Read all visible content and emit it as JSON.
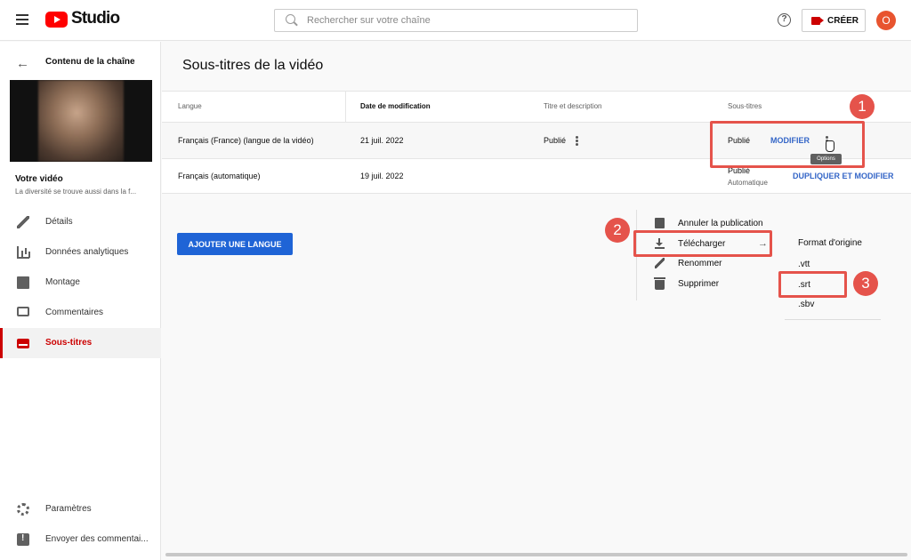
{
  "header": {
    "logo_text": "Studio",
    "search_placeholder": "Rechercher sur votre chaîne",
    "help_glyph": "?",
    "create_label": "CRÉER",
    "avatar_letter": "O",
    "avatar_color": "#e8542f"
  },
  "sidebar": {
    "channel_content": "Contenu de la chaîne",
    "your_video": "Votre vidéo",
    "video_description": "La diversité se trouve aussi dans la f...",
    "items": [
      {
        "label": "Détails",
        "icon": "pencil-icon"
      },
      {
        "label": "Données analytiques",
        "icon": "analytics-icon"
      },
      {
        "label": "Montage",
        "icon": "editor-icon"
      },
      {
        "label": "Commentaires",
        "icon": "comments-icon"
      },
      {
        "label": "Sous-titres",
        "icon": "subtitles-icon",
        "active": true
      }
    ],
    "bottom_items": [
      {
        "label": "Paramètres",
        "icon": "gear-icon"
      },
      {
        "label": "Envoyer des commentai...",
        "icon": "feedback-icon"
      }
    ]
  },
  "main": {
    "title": "Sous-titres de la vidéo",
    "columns": [
      "Langue",
      "Date de modification",
      "Titre et description",
      "Sous-titres"
    ],
    "rows": [
      {
        "language": "Français (France) (langue de la vidéo)",
        "date": "21 juil. 2022",
        "title_status": "Publié",
        "subs_status": "Publié",
        "action": "MODIFIER"
      },
      {
        "language": "Français (automatique)",
        "date": "19 juil. 2022",
        "title_status": "",
        "subs_status": "Publié",
        "subs_sub": "Automatique",
        "action": "DUPLIQUER ET MODIFIER"
      }
    ],
    "tooltip": "Options",
    "add_language": "AJOUTER UNE LANGUE"
  },
  "context_menu": {
    "items": [
      "Annuler la publication",
      "Télécharger",
      "Renommer",
      "Supprimer"
    ],
    "arrow_glyph": "→"
  },
  "download_submenu": {
    "items": [
      "Format d'origine",
      ".vtt",
      ".srt",
      ".sbv"
    ]
  },
  "annotations": {
    "badges": [
      "1",
      "2",
      "3"
    ],
    "color": "#e5534b"
  }
}
